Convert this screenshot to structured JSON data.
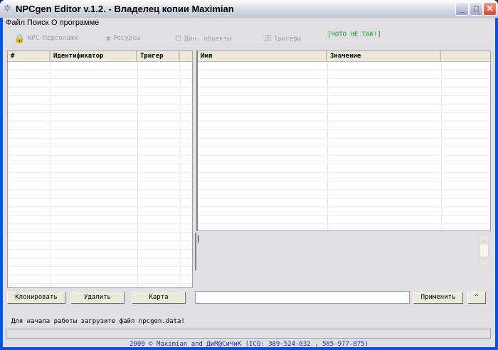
{
  "window": {
    "title": "NPCgen Editor v.1.2. - Владелец копии Maximian",
    "minimize": "_",
    "maximize": "□",
    "close": "✕"
  },
  "menu": [
    "Файл",
    "Поиск",
    "О программе"
  ],
  "toolbar": {
    "items": [
      {
        "label": "NPC-Персонажи",
        "icon": "🔒"
      },
      {
        "label": "Ресурсы",
        "icon": "⚗"
      },
      {
        "label": "Дин. объекты",
        "icon": "⏱"
      },
      {
        "label": "Тригеры",
        "icon": "⚿"
      }
    ],
    "warning": "[ЧОТО НЕ ТАК!]",
    "warning_color": "#18a018"
  },
  "left_table": {
    "columns": [
      "#",
      "Идентификатор",
      "Тригер",
      ""
    ]
  },
  "right_table": {
    "columns": [
      "Имя",
      "Значение",
      ""
    ]
  },
  "buttons": {
    "clone": "Клонировать",
    "delete": "Удалить",
    "map": "Карта",
    "apply": "Применить",
    "up": "^"
  },
  "value_input": "",
  "status": "Для начала работы загрузите файл npcgen.data!",
  "progress": 0,
  "footer": "2009 © Maximian and ДиМ@СиЧиК (ICQ: 389-524-032 , 585-977-875)"
}
